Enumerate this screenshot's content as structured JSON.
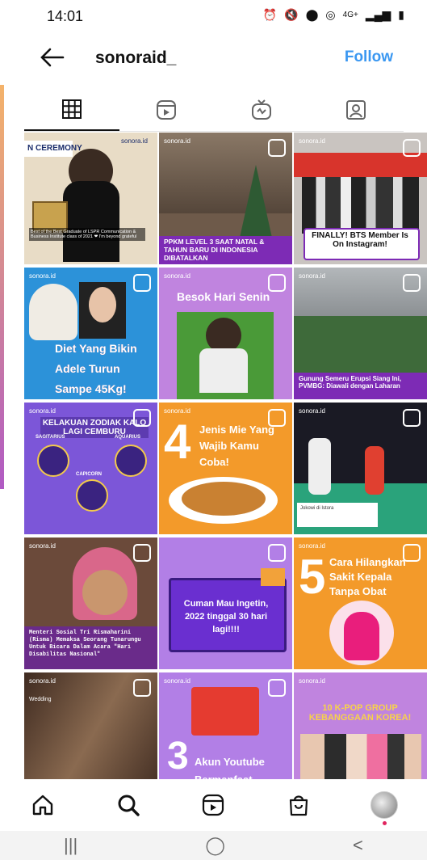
{
  "status_bar": {
    "time": "14:01",
    "network": "4G+",
    "icons": [
      "alarm-icon",
      "mute-icon",
      "location-icon",
      "hotspot-icon",
      "signal-icon",
      "battery-icon"
    ]
  },
  "header": {
    "title": "sonoraid_",
    "follow_label": "Follow",
    "follow_color": "#3a97f1"
  },
  "tabs": [
    {
      "name": "grid-icon",
      "active": true
    },
    {
      "name": "reels-icon",
      "active": false
    },
    {
      "name": "igtv-icon",
      "active": false
    },
    {
      "name": "tagged-icon",
      "active": false
    }
  ],
  "posts": [
    {
      "caption": "N CEREMONY",
      "caption2": "Best of the Best Graduate of LSPR Communication & Business Institute class of 2021 ❤ I'm beyond grateful",
      "brand": "sonora.id"
    },
    {
      "caption": "PPKM LEVEL 3 SAAT NATAL & TAHUN BARU DI INDONESIA DIBATALKAN",
      "brand": "sonora.id"
    },
    {
      "caption": "FINALLY! BTS Member Is On Instagram!",
      "brand": "sonora.id"
    },
    {
      "caption": "Diet Yang Bikin Adele Turun Sampe 45Kg!",
      "brand": "sonora.id"
    },
    {
      "caption": "Besok Hari Senin",
      "brand": "sonora.id"
    },
    {
      "caption": "Gunung Semeru Erupsi Siang Ini, PVMBG: Diawali dengan Laharan",
      "brand": "sonora.id"
    },
    {
      "caption": "KELAKUAN ZODIAK KALO LAGI CEMBURU",
      "sub": [
        "SAGITARIUS",
        "AQUARIUS",
        "CAPICORN"
      ],
      "brand": "sonora.id"
    },
    {
      "caption": "4",
      "caption2": "Jenis Mie Yang Wajib Kamu Coba!",
      "brand": "sonora.id"
    },
    {
      "caption": "Jokowi di Istora",
      "brand": "sonora.id"
    },
    {
      "caption": "Menteri Sosial Tri Rismaharini (Risma) Memaksa Seorang Tunarungu Untuk Bicara Dalam Acara \"Hari Disabilitas Nasional\"",
      "brand": "sonora.id"
    },
    {
      "caption": "Cuman Mau Ingetin, 2022 tinggal 30 hari lagi!!!!",
      "brand": "sonora.id"
    },
    {
      "caption": "5",
      "caption2": "Cara Hilangkan Sakit Kepala Tanpa Obat",
      "brand": "sonora.id"
    },
    {
      "caption": "Wedding",
      "brand": "sonora.id"
    },
    {
      "caption": "3",
      "caption2": "Akun Youtube Bermanfaat",
      "brand": "sonora.id"
    },
    {
      "caption": "10 K-POP GROUP KEBANGGAAN KOREA!",
      "brand": "sonora.id"
    }
  ],
  "bottom_nav": [
    "home-icon",
    "search-icon",
    "reels-icon",
    "shop-icon",
    "profile-avatar"
  ],
  "system_nav": {
    "recents": "|||",
    "home": "◯",
    "back": "<"
  }
}
